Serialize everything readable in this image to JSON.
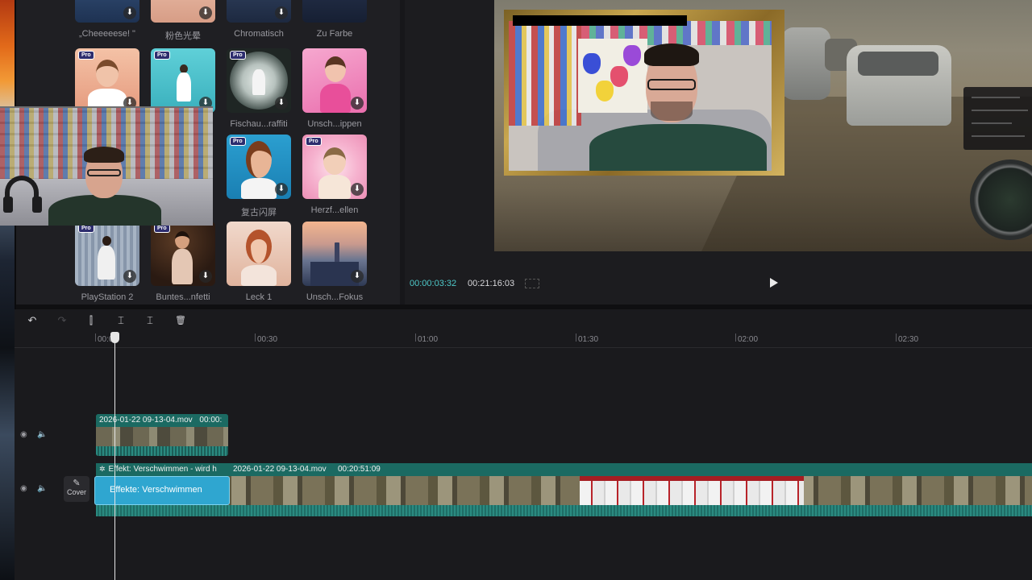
{
  "effects": {
    "row0": [
      "„Cheeeeese! \"",
      "粉色光晕",
      "Chromatisch",
      "Zu Farbe"
    ],
    "row1": [
      "",
      "",
      "Fischau...raffiti",
      "Unsch...ippen"
    ],
    "row2": [
      "",
      "",
      "复古闪屏",
      "Herzf...ellen"
    ],
    "row3": [
      "PlayStation 2",
      "Buntes...nfetti",
      "Leck 1",
      "Unsch...Fokus"
    ],
    "pro_badge": "Pro",
    "download_glyph": "⬇"
  },
  "preview": {
    "time_current": "00:00:03:32",
    "time_total": "00:21:16:03"
  },
  "toolbar": {
    "undo_icon": "↶",
    "redo_icon": "↷",
    "split_icon": "⫿",
    "split_left_icon": "⌶",
    "split_right_icon": "⌶",
    "delete_icon": "🗑"
  },
  "ruler": [
    "00:00",
    "00:30",
    "01:00",
    "01:30",
    "02:00",
    "02:30"
  ],
  "tracks": {
    "eye_icon": "◉",
    "speaker_icon": "🔈",
    "cover_label": "Cover",
    "cover_icon": "✎"
  },
  "clips": {
    "top_name": "2026-01-22 09-13-04.mov",
    "top_duration": "00:00:",
    "effect_header": "Effekt: Verschwimmen - wird h",
    "main_name": "2026-01-22 09-13-04.mov",
    "main_duration": "00:20:51:09",
    "effect_clip_label": "Effekte:  Verschwimmen"
  },
  "colors": {
    "accent_time": "#4ec9c9",
    "clip_teal": "#1b6a62",
    "effect_blue": "#2fa6d0"
  }
}
